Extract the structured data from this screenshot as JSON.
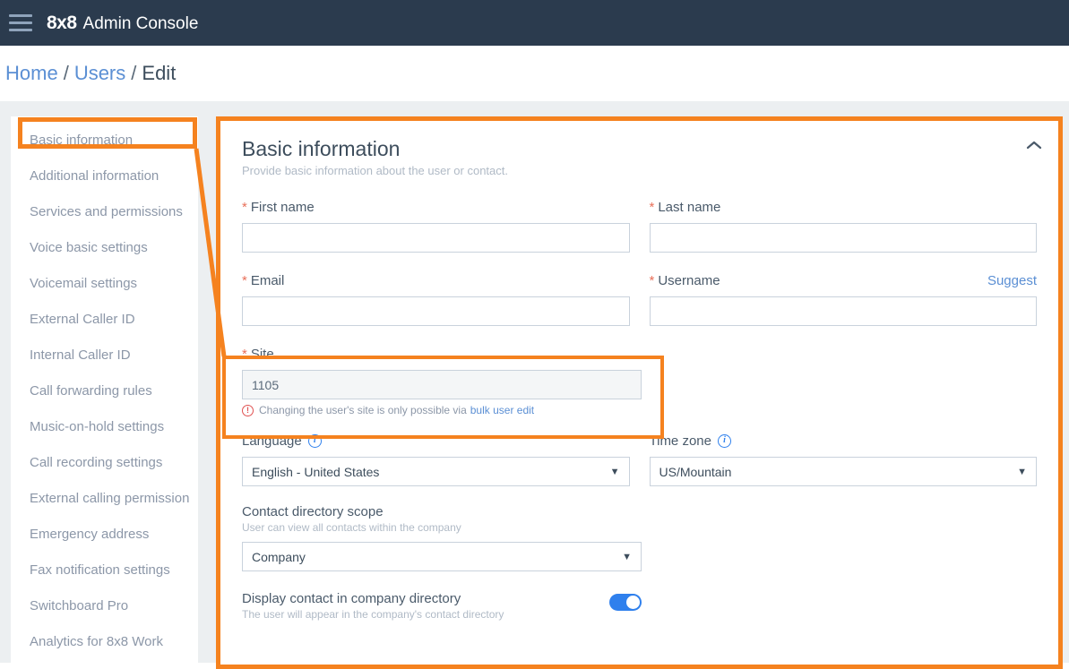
{
  "topbar": {
    "menu_icon": "hamburger-menu-icon",
    "logo": "8x8",
    "title": "Admin Console",
    "background": "#2b3b4e"
  },
  "breadcrumb": {
    "home": "Home",
    "sep1": "/",
    "users": "Users",
    "sep2": "/",
    "current": "Edit"
  },
  "sidebar": {
    "items": [
      {
        "label": "Basic information",
        "active": true
      },
      {
        "label": "Additional information",
        "active": false
      },
      {
        "label": "Services and permissions",
        "active": false
      },
      {
        "label": "Voice basic settings",
        "active": false
      },
      {
        "label": "Voicemail settings",
        "active": false
      },
      {
        "label": "External Caller ID",
        "active": false
      },
      {
        "label": "Internal Caller ID",
        "active": false
      },
      {
        "label": "Call forwarding rules",
        "active": false
      },
      {
        "label": "Music-on-hold settings",
        "active": false
      },
      {
        "label": "Call recording settings",
        "active": false
      },
      {
        "label": "External calling permission",
        "active": false
      },
      {
        "label": "Emergency address",
        "active": false
      },
      {
        "label": "Fax notification settings",
        "active": false
      },
      {
        "label": "Switchboard Pro",
        "active": false
      },
      {
        "label": "Analytics for 8x8 Work",
        "active": false
      }
    ]
  },
  "card": {
    "title": "Basic information",
    "subtitle": "Provide basic information about the user or contact.",
    "collapse_icon": "chevron-up-icon",
    "fields": {
      "first_name": {
        "label": "First name",
        "required": true,
        "value": "",
        "placeholder": ""
      },
      "last_name": {
        "label": "Last name",
        "required": true,
        "value": "",
        "placeholder": ""
      },
      "email": {
        "label": "Email",
        "required": true,
        "value": "",
        "placeholder": ""
      },
      "username": {
        "label": "Username",
        "required": true,
        "value": "",
        "placeholder": "",
        "action_label": "Suggest"
      },
      "site": {
        "label": "Site",
        "required": true,
        "value": "1105",
        "disabled": true,
        "note_icon": "warning-circle-icon",
        "note_text": "Changing the user's site is only possible via",
        "note_link": "bulk user edit"
      },
      "language": {
        "label": "Language",
        "info_icon": "info-circle-icon",
        "value": "English - United States",
        "caret": "▼"
      },
      "timezone": {
        "label": "Time zone",
        "info_icon": "info-circle-icon",
        "value": "US/Mountain",
        "caret": "▼"
      },
      "contact_scope": {
        "label": "Contact directory scope",
        "sublabel": "User can view all contacts within the company",
        "value": "Company",
        "caret": "▼"
      },
      "display_contact": {
        "label": "Display contact in company directory",
        "sublabel": "The user will appear in the company's contact directory",
        "state": "on"
      }
    }
  },
  "annotations": {
    "color": "#f5821f",
    "sidebar_highlight": "Basic information",
    "field_highlight": "Site",
    "connector": "callout-line"
  }
}
